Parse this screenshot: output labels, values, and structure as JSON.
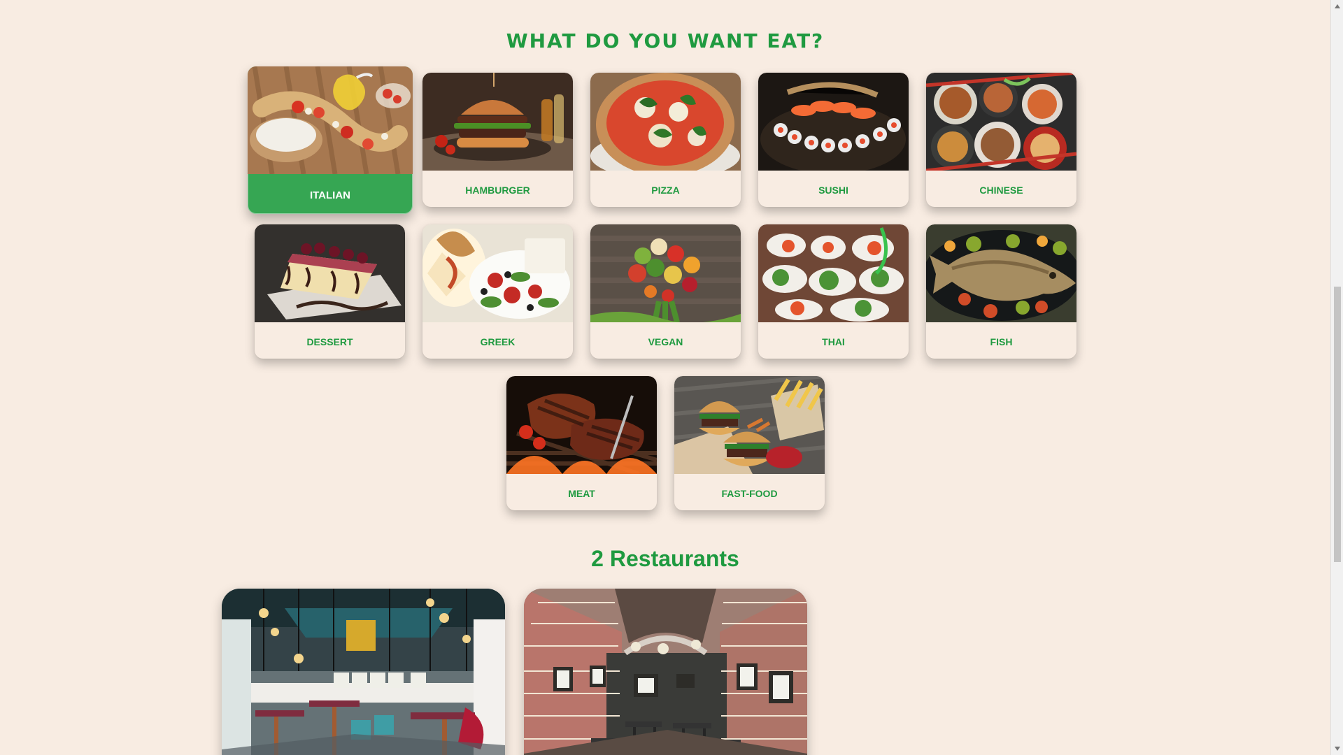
{
  "page": {
    "title": "WHAT DO YOU WANT EAT?",
    "restaurants_title": "2 Restaurants"
  },
  "categories": [
    {
      "label": "ITALIAN",
      "selected": true
    },
    {
      "label": "HAMBURGER"
    },
    {
      "label": "PIZZA"
    },
    {
      "label": "SUSHI"
    },
    {
      "label": "CHINESE"
    },
    {
      "label": "DESSERT"
    },
    {
      "label": "GREEK"
    },
    {
      "label": "VEGAN"
    },
    {
      "label": "THAI"
    },
    {
      "label": "FISH"
    },
    {
      "label": "MEAT"
    },
    {
      "label": "FAST-FOOD"
    }
  ],
  "theme": {
    "accent_green": "#1f9a40",
    "active_green": "#36a653",
    "background": "#f8ece2"
  }
}
